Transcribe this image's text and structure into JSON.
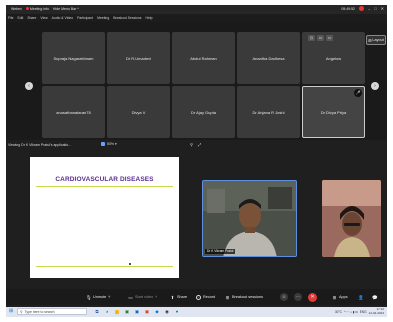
{
  "titlebar": {
    "app_name": "Webex",
    "recording_label": "Meeting info",
    "host_label": "Hide Menu Bar ^",
    "time": "05:49:52",
    "min_glyph": "–",
    "max_glyph": "□",
    "close_glyph": "✕"
  },
  "menu": [
    "File",
    "Edit",
    "Share",
    "View",
    "Audio & Video",
    "Participant",
    "Meeting",
    "Breakout Sessions",
    "Help"
  ],
  "gallery": {
    "tiles": [
      {
        "name": "Supraja Nagarathinam"
      },
      {
        "name": "Dr R.Umadevi"
      },
      {
        "name": "Abdul Rahman"
      },
      {
        "name": "Anantha Dadhesa"
      },
      {
        "name": "Angelow"
      },
      {
        "name": "anusathanataran78"
      },
      {
        "name": "Divya V"
      },
      {
        "name": "Dr Ajay Gupta"
      },
      {
        "name": "Dr Anjana R Joshi"
      },
      {
        "name": "Dr Divya Priya"
      }
    ],
    "layout_label": "Layout",
    "mic_glyph": "🎤",
    "prev_glyph": "‹",
    "next_glyph": "›",
    "control_glyphs": [
      "◷",
      "▭",
      "▭"
    ]
  },
  "share": {
    "label": "Viewing Dr K Vikram Pratul's applicatio...",
    "zoom": "50%",
    "zoom_caret": "▾",
    "icons": [
      "⚲",
      "⤢"
    ]
  },
  "slide": {
    "title": "CARDIOVASCULAR DISEASES"
  },
  "videos": [
    {
      "name": "Dr K Vikram Pratul"
    },
    {
      "name": ""
    }
  ],
  "toolbar": {
    "unmute": "Unmute",
    "start_video": "Start video",
    "share": "Share",
    "record": "Record",
    "breakout": "Breakout sessions",
    "apps": "Apps",
    "leave_glyph": "✕",
    "caret": "˅",
    "unmute_icon": "🎙",
    "video_icon": "▭",
    "share_icon": "⬆",
    "breakout_icon": "⊞",
    "apps_icon": "⊞",
    "participants_icon": "👤",
    "reactions_glyph": "☺",
    "more_glyph": "⋯",
    "chat_glyph": "💬"
  },
  "taskbar": {
    "search_placeholder": "Type here to search",
    "search_icon": "⚲",
    "start_glyph": "⊞",
    "weather": "30°C",
    "lang": "ENG",
    "time": "17:10",
    "date": "14-04-2023",
    "tray_glyphs": "^ ◠ ⌂ ▮ ⧉"
  },
  "colors": {
    "slide_title": "#5b2c91",
    "slide_rule": "#c7d94c",
    "leave": "#e53935",
    "active_speaker_border": "#5e8fe0",
    "taskbar": "#dfe6f2"
  }
}
